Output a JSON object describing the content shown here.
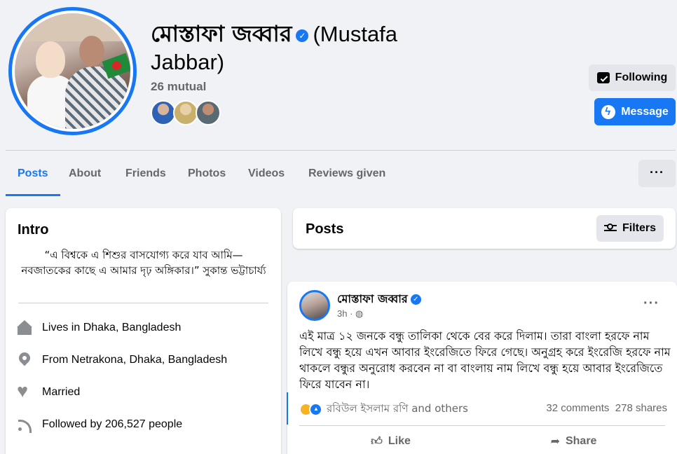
{
  "profile": {
    "name_bn": "মোস্তাফা জব্বার",
    "name_en": "(Mustafa Jabbar)",
    "mutual": "26 mutual",
    "following_label": "Following",
    "message_label": "Message"
  },
  "tabs": [
    {
      "label": "Posts"
    },
    {
      "label": "About"
    },
    {
      "label": "Friends"
    },
    {
      "label": "Photos"
    },
    {
      "label": "Videos"
    },
    {
      "label": "Reviews given"
    }
  ],
  "intro": {
    "title": "Intro",
    "bio": "“এ বিশ্বকে এ শিশুর বাসযোগ্য করে যাব আমি— নবজাতকের কাছে এ আমার দৃঢ় অঙ্গিকার।” সুকান্ত ভট্টাচার্য্য",
    "rows": [
      {
        "icon": "home-icon",
        "prefix": "Lives in ",
        "value": "Dhaka, Bangladesh"
      },
      {
        "icon": "location-pin-icon",
        "prefix": "From ",
        "value": "Netrakona, Dhaka, Bangladesh"
      },
      {
        "icon": "heart-icon",
        "prefix": "Married",
        "value": ""
      },
      {
        "icon": "rss-icon",
        "prefix": "Followed by ",
        "value": "206,527 people"
      }
    ]
  },
  "posts_header": {
    "title": "Posts",
    "filters_label": "Filters"
  },
  "post": {
    "author": "মোস্তাফা জব্বার",
    "time": "3h · ",
    "text": "এই মাত্র ১২ জনকে বন্ধু তালিকা থেকে বের করে দিলাম। তারা বাংলা হরফে নাম লিখে বন্ধু হয়ে এখন আবার ইংরেজিতে ফিরে গেছে। অনুগ্রহ করে ইংরেজি হরফে নাম থাকলে বন্ধুর অনুরোধ করবেন না বা বাংলায় নাম লিখে বন্ধু হয়ে আবার ইংরেজিতে ফিরে যাবেন না।",
    "reactors": "রবিউল ইসলাম রণি and others",
    "comments": "32 comments",
    "shares": "278 shares",
    "like_label": "Like",
    "share_label": "Share"
  },
  "colors": {
    "accent": "#1877f2",
    "background": "#f0f2f5",
    "secondary_text": "#65676b"
  }
}
